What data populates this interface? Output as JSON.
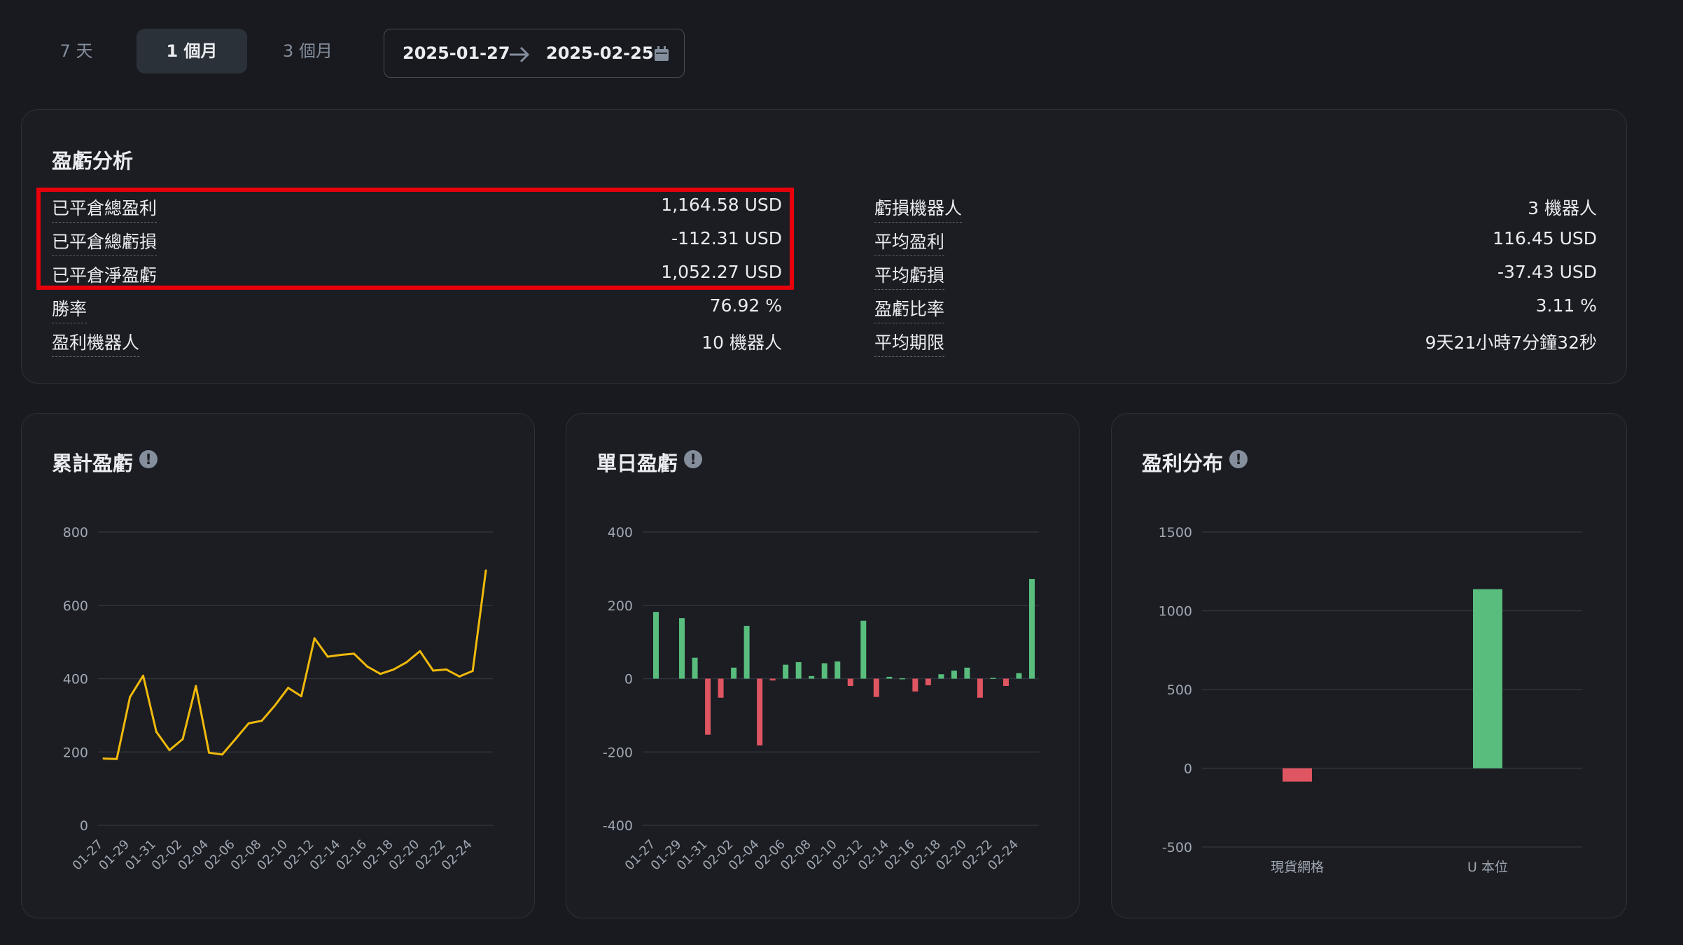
{
  "period_tabs": [
    "7 天",
    "1 個月",
    "3 個月"
  ],
  "active_tab": "1 個月",
  "date_range": {
    "start": "2025-01-27",
    "end": "2025-02-25"
  },
  "pnl_analysis": {
    "title": "盈虧分析",
    "left_stats": [
      {
        "label": "已平倉總盈利",
        "value": "1,164.58 USD"
      },
      {
        "label": "已平倉總虧損",
        "value": "-112.31 USD"
      },
      {
        "label": "已平倉淨盈虧",
        "value": "1,052.27 USD"
      },
      {
        "label": "勝率",
        "value": "76.92 %"
      },
      {
        "label": "盈利機器人",
        "value": "10 機器人"
      }
    ],
    "right_stats": [
      {
        "label": "虧損機器人",
        "value": "3 機器人"
      },
      {
        "label": "平均盈利",
        "value": "116.45 USD"
      },
      {
        "label": "平均虧損",
        "value": "-37.43 USD"
      },
      {
        "label": "盈虧比率",
        "value": "3.11 %"
      },
      {
        "label": "平均期限",
        "value": "9天21小時7分鐘32秒"
      }
    ]
  },
  "colors": {
    "background": "#181a20",
    "line": "#f0b90b",
    "positive": "#58bd7d",
    "negative": "#e05562",
    "highlight": "#e8000b"
  },
  "chart_data": [
    {
      "type": "line",
      "title": "累計盈虧",
      "x": [
        "01-27",
        "01-28",
        "01-29",
        "01-30",
        "01-31",
        "02-01",
        "02-02",
        "02-03",
        "02-04",
        "02-05",
        "02-06",
        "02-07",
        "02-08",
        "02-09",
        "02-10",
        "02-11",
        "02-12",
        "02-13",
        "02-14",
        "02-15",
        "02-16",
        "02-17",
        "02-18",
        "02-19",
        "02-20",
        "02-21",
        "02-22",
        "02-23",
        "02-24",
        "02-25"
      ],
      "values": [
        182,
        181,
        350,
        408,
        255,
        205,
        235,
        380,
        198,
        193,
        235,
        278,
        285,
        327,
        375,
        352,
        510,
        460,
        465,
        468,
        433,
        413,
        425,
        445,
        475,
        422,
        425,
        406,
        421,
        695
      ],
      "x_tick_labels": [
        "01-27",
        "01-29",
        "01-31",
        "02-02",
        "02-04",
        "02-06",
        "02-08",
        "02-10",
        "02-12",
        "02-14",
        "02-16",
        "02-18",
        "02-20",
        "02-22",
        "02-24"
      ],
      "yticks": [
        0,
        200,
        400,
        600,
        800
      ],
      "ylim": [
        0,
        800
      ],
      "grid": true
    },
    {
      "type": "bar",
      "title": "單日盈虧",
      "x": [
        "01-27",
        "01-28",
        "01-29",
        "01-30",
        "01-31",
        "02-01",
        "02-02",
        "02-03",
        "02-04",
        "02-05",
        "02-06",
        "02-07",
        "02-08",
        "02-09",
        "02-10",
        "02-11",
        "02-12",
        "02-13",
        "02-14",
        "02-15",
        "02-16",
        "02-17",
        "02-18",
        "02-19",
        "02-20",
        "02-21",
        "02-22",
        "02-23",
        "02-24",
        "02-25"
      ],
      "values": [
        182,
        0,
        165,
        57,
        -153,
        -52,
        30,
        144,
        -182,
        -5,
        38,
        45,
        7,
        42,
        47,
        -20,
        158,
        -50,
        5,
        1,
        -35,
        -18,
        12,
        22,
        30,
        -52,
        2,
        -20,
        15,
        272
      ],
      "x_tick_labels": [
        "01-27",
        "01-29",
        "01-31",
        "02-02",
        "02-04",
        "02-06",
        "02-08",
        "02-10",
        "02-12",
        "02-14",
        "02-16",
        "02-18",
        "02-20",
        "02-22",
        "02-24"
      ],
      "yticks": [
        -400,
        -200,
        0,
        200,
        400
      ],
      "ylim": [
        -400,
        400
      ],
      "grid": true
    },
    {
      "type": "bar",
      "title": "盈利分布",
      "categories": [
        "現貨網格",
        "U 本位"
      ],
      "values": [
        -85,
        1137
      ],
      "yticks": [
        -500,
        0,
        500,
        1000,
        1500
      ],
      "ylim": [
        -500,
        1500
      ],
      "grid": true
    }
  ]
}
